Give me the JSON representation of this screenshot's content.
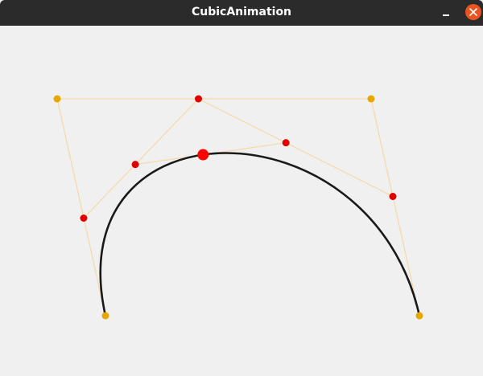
{
  "window": {
    "title": "CubicAnimation",
    "accent_close": "#e95420",
    "titlebar_color": "#2b2b2b",
    "icons": {
      "minimize": "minimize-icon",
      "close": "close-icon"
    }
  },
  "scene": {
    "colors": {
      "control_point": "#e6a800",
      "construction_line": "#f5d9a8",
      "intermediate_point": "#e00000",
      "curve": "#1a1a1a",
      "current_point": "#ff0000"
    },
    "t": 0.45
  }
}
